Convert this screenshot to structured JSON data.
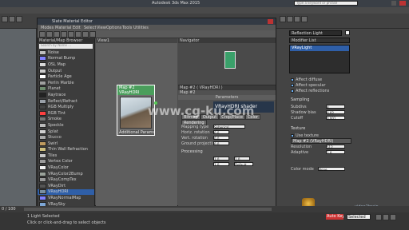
{
  "app": {
    "title": "Autodesk 3ds Max 2015",
    "search_placeholder": "Type a keyword or phrase"
  },
  "slate": {
    "title": "Slate Material Editor",
    "menu": [
      "Modes",
      "Material",
      "Edit",
      "Select",
      "View",
      "Options",
      "Tools",
      "Utilities"
    ],
    "browser_header": "Material/Map Browser",
    "search_placeholder": "Search by Name ...",
    "view_tab": "View1",
    "navigator_title": "Navigator",
    "materials": [
      {
        "name": "Noise",
        "color": "#bfbfbf"
      },
      {
        "name": "Normal Bump",
        "color": "#8080ff"
      },
      {
        "name": "OSL Map",
        "color": "#d9d9d9"
      },
      {
        "name": "Output",
        "color": "#cccccc"
      },
      {
        "name": "Particle Age",
        "color": "#ffffff"
      },
      {
        "name": "Perlin Marble",
        "color": "#a0a0a0"
      },
      {
        "name": "Planet",
        "color": "#6e8c6e"
      },
      {
        "name": "Raytrace",
        "color": "#222222"
      },
      {
        "name": "Reflect/Refract",
        "color": "#9aa0a8"
      },
      {
        "name": "RGB Multiply",
        "color": "#444444"
      },
      {
        "name": "RGB Tint",
        "color": "#ff4040"
      },
      {
        "name": "Smoke",
        "color": "#777777"
      },
      {
        "name": "Speckle",
        "color": "#bbbbbb"
      },
      {
        "name": "Splat",
        "color": "#d0d0d0"
      },
      {
        "name": "Stucco",
        "color": "#aaaaaa"
      },
      {
        "name": "Swirl",
        "color": "#bf9b5f"
      },
      {
        "name": "Thin Wall Refraction",
        "color": "#cfc080"
      },
      {
        "name": "Tiles",
        "color": "#c8c8c8"
      },
      {
        "name": "Vertex Color",
        "color": "#9a9a9a"
      },
      {
        "name": "VRayColor",
        "color": "#f0f0f0"
      },
      {
        "name": "VRayColor2Bump",
        "color": "#9aa29a"
      },
      {
        "name": "VRayCompTex",
        "color": "#999999"
      },
      {
        "name": "VRayDirt",
        "color": "#555555"
      },
      {
        "name": "VRayHDRI",
        "color": "#7a8fa0"
      },
      {
        "name": "VRayNormalMap",
        "color": "#8080ff"
      },
      {
        "name": "VRaySky",
        "color": "#7ea7d6"
      },
      {
        "name": "Waves",
        "color": "#4a7ab0"
      },
      {
        "name": "Wood",
        "color": "#8b6a3e"
      }
    ],
    "node": {
      "title": "Map #2",
      "subtitle": "VRayHDRI",
      "output": "Additional Params"
    },
    "params": {
      "title": "Map #2 ( VRayHDRI )",
      "subheader": "Map #2",
      "rollout": "Parameters",
      "banner": "VRayHDRI shader",
      "tabs": [
        "Bitmap",
        "Output",
        "Crop/Place",
        "Color",
        "Rendering"
      ],
      "mapping_label": "Mapping type",
      "mapping_value": "Spherical",
      "fields": [
        {
          "label": "Horiz. rotation",
          "value": "0.0"
        },
        {
          "label": "Vert. rotation",
          "value": "0.0"
        },
        {
          "label": "Ground projection",
          "value": "0.0"
        }
      ],
      "processing": "Processing",
      "overall_mult": "1.0",
      "render_mult": "1.0",
      "gamma": "1.0",
      "interpolation": "Default"
    }
  },
  "right_panel": {
    "object_name": "Reflection Light",
    "modifier_list": "Modifier List",
    "stack_item": "VRayLight",
    "options": [
      "Affect diffuse",
      "Affect specular",
      "Affect reflections"
    ],
    "sampling": "Sampling",
    "subdivs_label": "Subdivs",
    "subdivs_value": "8",
    "shadow_bias_label": "Shadow bias",
    "shadow_bias_value": "0.02",
    "cutoff_label": "Cutoff",
    "cutoff_value": "0.001",
    "texture_label": "Texture",
    "use_texture": "Use texture",
    "texture_map": "Map #2 (VRayHDRI)",
    "resolution_label": "Resolution",
    "resolution_value": "512",
    "adaptive_label": "Adaptive",
    "adaptive_value": "1.0",
    "color_mode_label": "Color mode",
    "color_mode_value": "None"
  },
  "status": {
    "selection": "1 Light Selected",
    "hint": "Click or click-and-drag to select objects",
    "frame": "0 / 100",
    "key_mode": "Selected",
    "auto_key": "Auto Key"
  },
  "watermark": {
    "text": "www.cg-ku.com"
  },
  "colors": {
    "accent": "#6fb7ff",
    "node_header": "#4a9e5c",
    "selection": "#2f5fa8"
  }
}
